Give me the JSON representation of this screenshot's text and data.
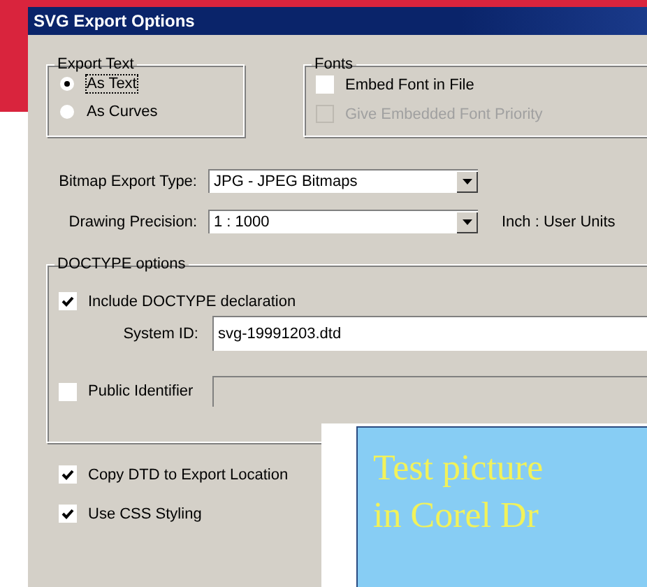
{
  "window": {
    "title": "SVG Export Options"
  },
  "export_text": {
    "label": "Export Text",
    "options": [
      {
        "label": "As Text",
        "selected": true
      },
      {
        "label": "As Curves",
        "selected": false
      }
    ]
  },
  "fonts": {
    "label": "Fonts",
    "options": [
      {
        "label": "Embed Font in File",
        "checked": false,
        "disabled": false
      },
      {
        "label": "Give Embedded Font Priority",
        "checked": false,
        "disabled": true
      }
    ]
  },
  "bitmap_export_type": {
    "label": "Bitmap Export Type:",
    "value": "JPG - JPEG Bitmaps"
  },
  "drawing_precision": {
    "label": "Drawing Precision:",
    "value": "1 : 1000",
    "unit": "Inch : User Units"
  },
  "doctype": {
    "label": "DOCTYPE options",
    "include": {
      "label": "Include DOCTYPE declaration",
      "checked": true
    },
    "system_id": {
      "label": "System ID:",
      "value": "svg-19991203.dtd"
    },
    "public_identifier": {
      "label": "Public Identifier",
      "checked": false
    }
  },
  "options": [
    {
      "label": "Copy DTD to Export Location",
      "checked": true
    },
    {
      "label": "Use CSS Styling",
      "checked": true
    }
  ],
  "overlay": {
    "lines": [
      "Test picture",
      "in Corel Dr"
    ]
  }
}
